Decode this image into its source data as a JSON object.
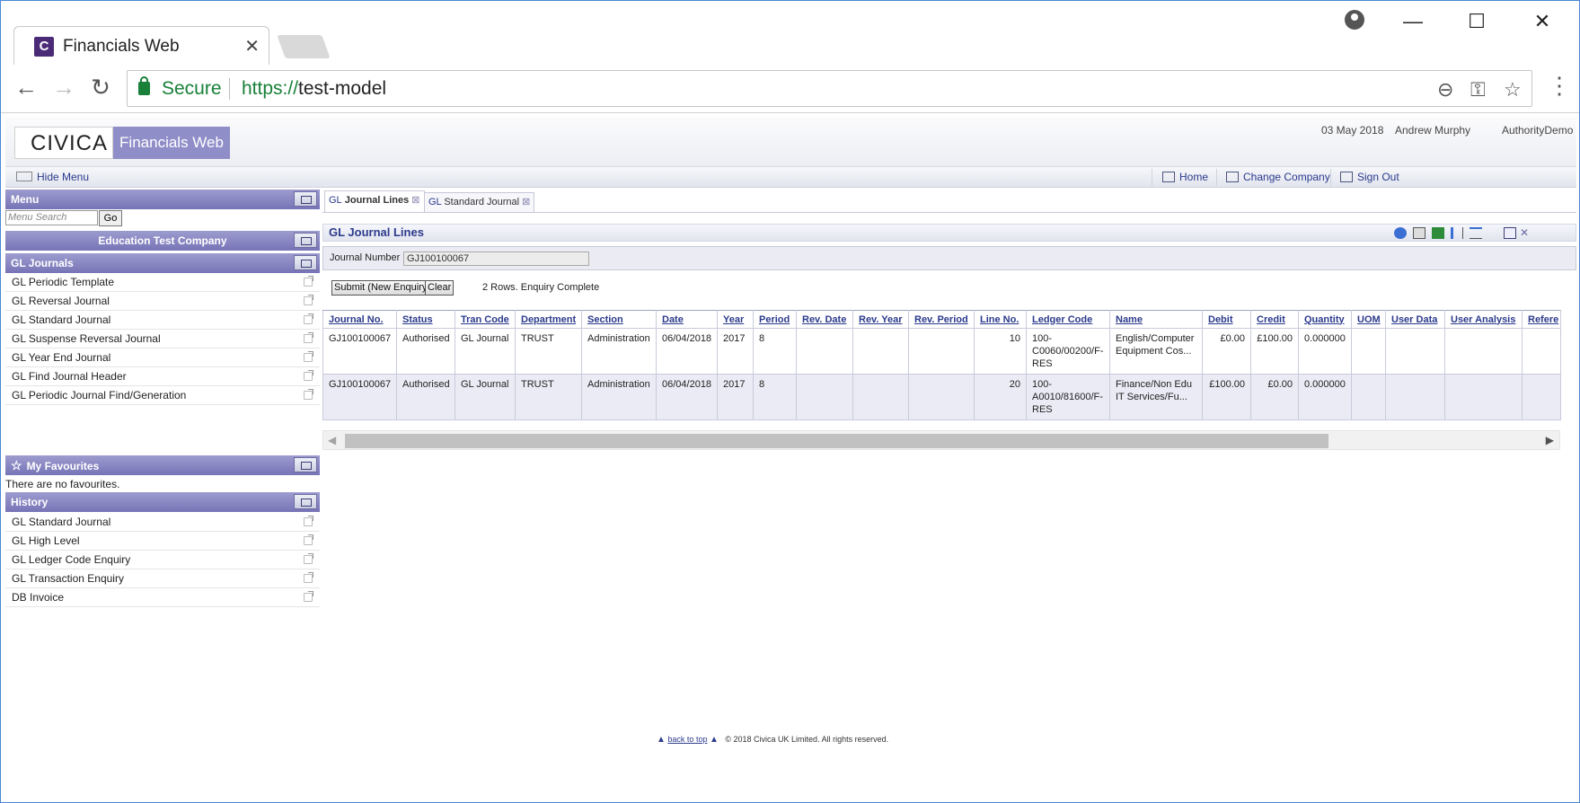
{
  "browser": {
    "tab_title": "Financials Web",
    "tab_favicon": "C",
    "tab_close": "✕",
    "secure_label": "Secure",
    "url_scheme": "https://",
    "url_host": "test-model",
    "back_icon": "←",
    "forward_icon": "→",
    "reload_icon": "↻",
    "zoom_icon": "⊖",
    "key_icon": "⚿",
    "star_icon": "☆",
    "menu_icon": "⋮",
    "min_icon": "—",
    "max_icon": "☐",
    "close_icon": "✕"
  },
  "header": {
    "logo": "CIVICA",
    "app_name": "Financials Web",
    "date": "03 May 2018",
    "user": "Andrew Murphy",
    "authority": "AuthorityDemo"
  },
  "subbar": {
    "hide_menu": "Hide Menu",
    "home": "Home",
    "change_company": "Change Company",
    "sign_out": "Sign Out"
  },
  "sidebar": {
    "menu_title": "Menu",
    "search_placeholder": "Menu Search",
    "go_label": "Go",
    "company": "Education Test Company",
    "section_title": "GL Journals",
    "items": [
      "GL Periodic Template",
      "GL Reversal Journal",
      "GL Standard Journal",
      "GL Suspense Reversal Journal",
      "GL Year End Journal",
      "GL Find Journal Header",
      "GL Periodic Journal Find/Generation"
    ],
    "favourites_title": "My Favourites",
    "favourites_empty": "There are no favourites.",
    "history_title": "History",
    "history": [
      "GL Standard Journal",
      "GL High Level",
      "GL Ledger Code Enquiry",
      "GL Transaction Enquiry",
      "DB Invoice"
    ]
  },
  "content": {
    "tabs": [
      {
        "prefix": "GL",
        "label": "Journal Lines",
        "active": true
      },
      {
        "prefix": "GL",
        "label": "Standard Journal",
        "active": false
      }
    ],
    "tab_close": "⊠",
    "enquiry_title": "GL Journal Lines",
    "journal_number_label": "Journal Number",
    "journal_number_value": "GJ100100067",
    "submit_label": "Submit (New Enquiry)",
    "clear_label": "Clear",
    "status": "2 Rows. Enquiry Complete",
    "columns": [
      "Journal No.",
      "Status",
      "Tran Code",
      "Department",
      "Section",
      "Date",
      "Year",
      "Period",
      "Rev. Date",
      "Rev. Year",
      "Rev. Period",
      "Line No.",
      "Ledger Code",
      "Name",
      "Debit",
      "Credit",
      "Quantity",
      "UOM",
      "User Data",
      "User Analysis",
      "Refere"
    ],
    "rows": [
      [
        "GJ100100067",
        "Authorised",
        "GL Journal",
        "TRUST",
        "Administration",
        "06/04/2018",
        "2017",
        "8",
        "",
        "",
        "",
        "10",
        "100-C0060/00200/F-RES",
        "English/Computer Equipment Cos...",
        "£0.00",
        "£100.00",
        "0.000000",
        "",
        "",
        "",
        ""
      ],
      [
        "GJ100100067",
        "Authorised",
        "GL Journal",
        "TRUST",
        "Administration",
        "06/04/2018",
        "2017",
        "8",
        "",
        "",
        "",
        "20",
        "100-A0010/81600/F-RES",
        "Finance/Non Edu IT Services/Fu...",
        "£100.00",
        "£0.00",
        "0.000000",
        "",
        "",
        "",
        ""
      ]
    ]
  },
  "footer": {
    "back_to_top": "back to top",
    "copyright": "© 2018 Civica UK Limited. All rights reserved."
  }
}
